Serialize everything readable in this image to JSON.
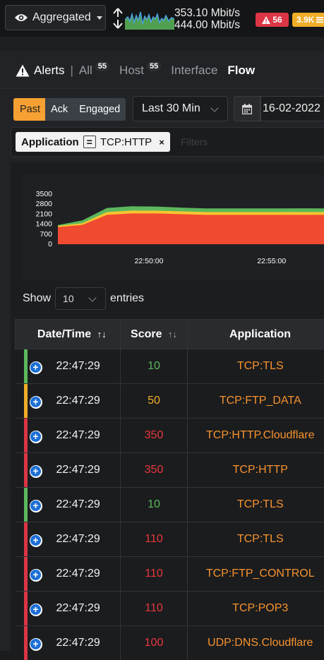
{
  "topbar": {
    "aggregated_label": "Aggregated",
    "rate_upload": "353.10 Mbit/s",
    "rate_download": "444.00 Mbit/s",
    "alert_badge": "56",
    "flow_badge": "3.9K",
    "colors": {
      "danger": "#dc3545",
      "warning": "#f0ad28"
    }
  },
  "nav": {
    "title": "Alerts",
    "all_label": "All",
    "all_count": "55",
    "host_label": "Host",
    "host_count": "55",
    "interface_label": "Interface",
    "flow_label": "Flow"
  },
  "controls": {
    "status_tabs": [
      "Past",
      "Ack",
      "Engaged"
    ],
    "active_tab": "Past",
    "time_range": "Last 30 Min",
    "date_value": "16-02-2022"
  },
  "filter": {
    "key": "Application",
    "operator": "=",
    "value": "TCP:HTTP",
    "placeholder": "Filters"
  },
  "chart_data": {
    "type": "area",
    "yticks": [
      "0",
      "700",
      "1400",
      "2100",
      "2800",
      "3500"
    ],
    "xticks": [
      "22:50:00",
      "22:55:00"
    ],
    "ylim": [
      0,
      3500
    ],
    "x": [
      "22:46:00",
      "22:47:00",
      "22:48:00",
      "22:49:00",
      "22:50:00",
      "22:51:00",
      "22:52:00",
      "22:53:00",
      "22:54:00",
      "22:55:00",
      "22:56:00",
      "22:57:00",
      "22:58:00"
    ],
    "series": [
      {
        "color": "#f04a30",
        "values": [
          1200,
          1350,
          2050,
          2150,
          2150,
          2100,
          2050,
          2050,
          2050,
          2050,
          2050,
          2050,
          2050
        ]
      },
      {
        "color": "#f7c531",
        "values": [
          80,
          120,
          200,
          200,
          200,
          200,
          200,
          200,
          200,
          200,
          200,
          200,
          200
        ]
      },
      {
        "color": "#5cb85c",
        "values": [
          60,
          200,
          280,
          300,
          280,
          260,
          250,
          250,
          250,
          250,
          260,
          250,
          250
        ]
      }
    ]
  },
  "table": {
    "show_label": "Show",
    "entries_value": "10",
    "entries_label": "entries",
    "columns": [
      "Date/Time",
      "Score",
      "Application"
    ],
    "rows": [
      {
        "time": "22:47:29",
        "score": "10",
        "app": "TCP:TLS",
        "severity": "#5cb85c",
        "score_color": "#5cb85c"
      },
      {
        "time": "22:47:29",
        "score": "50",
        "app": "TCP:FTP_DATA",
        "severity": "#f0ad28",
        "score_color": "#f0ad28"
      },
      {
        "time": "22:47:29",
        "score": "350",
        "app": "TCP:HTTP.Cloudflare",
        "severity": "#dc3545",
        "score_color": "#e8383d"
      },
      {
        "time": "22:47:29",
        "score": "350",
        "app": "TCP:HTTP",
        "severity": "#dc3545",
        "score_color": "#e8383d"
      },
      {
        "time": "22:47:29",
        "score": "10",
        "app": "TCP:TLS",
        "severity": "#5cb85c",
        "score_color": "#5cb85c"
      },
      {
        "time": "22:47:29",
        "score": "110",
        "app": "TCP:TLS",
        "severity": "#dc3545",
        "score_color": "#e8383d"
      },
      {
        "time": "22:47:29",
        "score": "110",
        "app": "TCP:FTP_CONTROL",
        "severity": "#dc3545",
        "score_color": "#e8383d"
      },
      {
        "time": "22:47:29",
        "score": "110",
        "app": "TCP:POP3",
        "severity": "#dc3545",
        "score_color": "#e8383d"
      },
      {
        "time": "22:47:29",
        "score": "100",
        "app": "UDP:DNS.Cloudflare",
        "severity": "#dc3545",
        "score_color": "#e8383d"
      }
    ]
  }
}
